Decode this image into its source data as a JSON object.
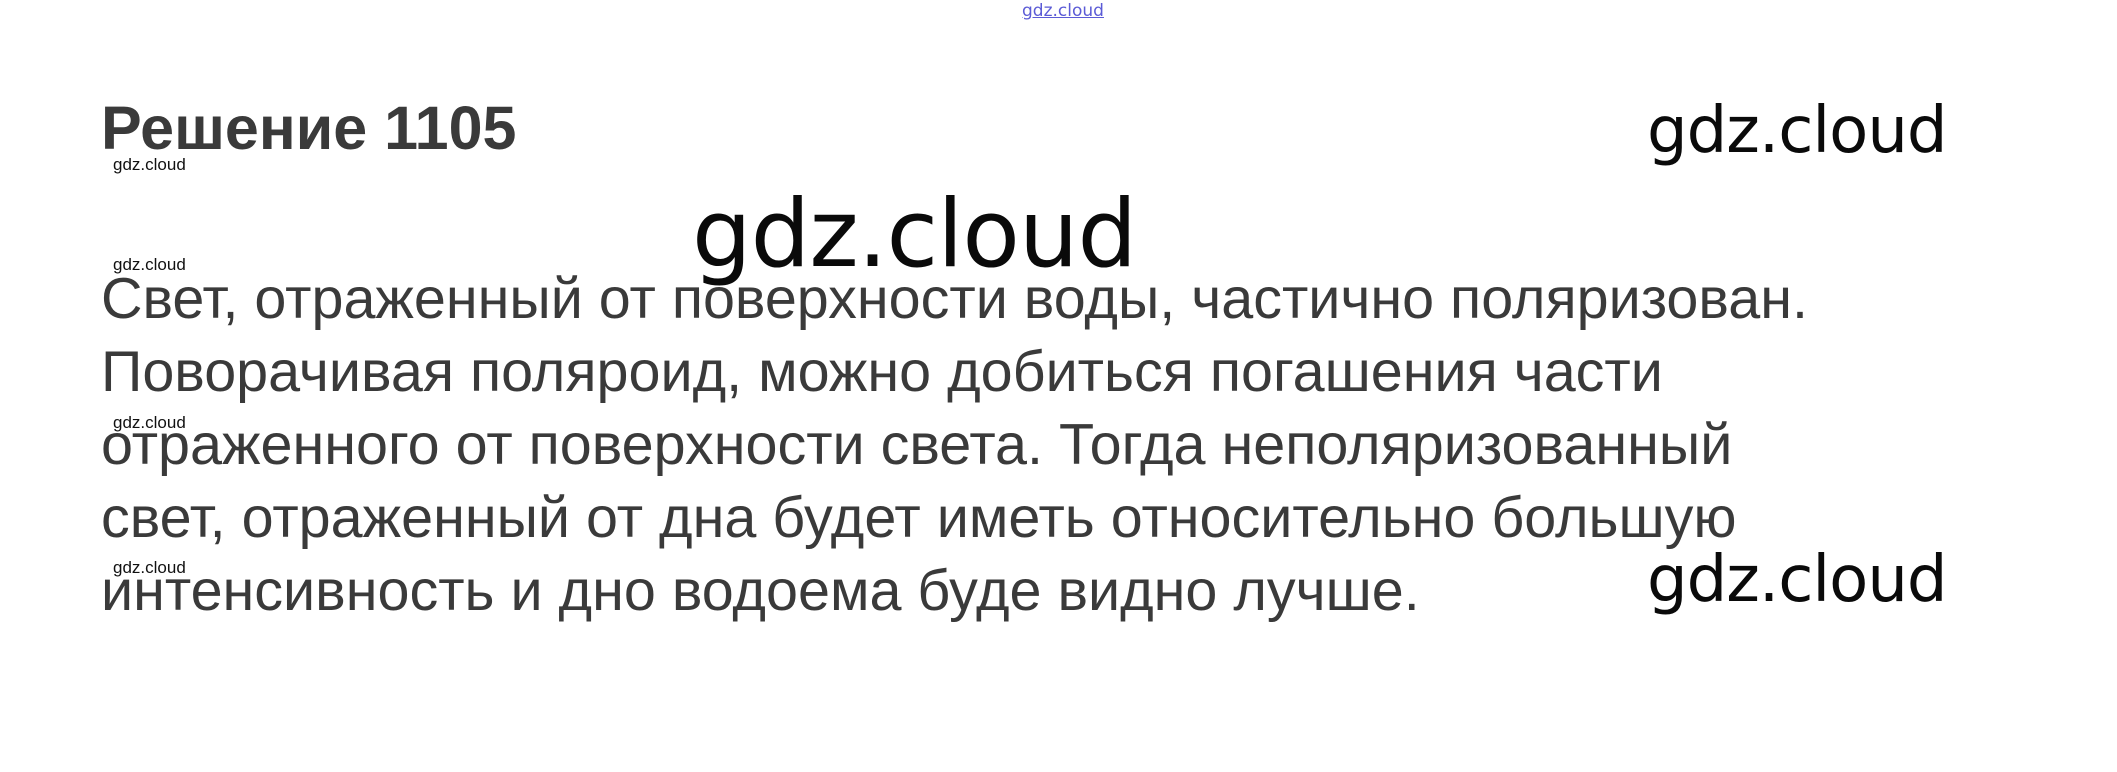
{
  "header": {
    "top_link": "gdz.cloud"
  },
  "solution": {
    "title": "Решение 1105",
    "lines": [
      "Свет, отраженный от поверхности воды, частично поляризован.",
      "Поворачивая поляроид, можно добиться погашения части",
      "отраженного от поверхности света. Тогда неполяризованный",
      "свет, отраженный от дна будет иметь относительно большую",
      "интенсивность и дно водоема буде видно лучше."
    ]
  },
  "watermarks": {
    "small": [
      "gdz.cloud",
      "gdz.cloud",
      "gdz.cloud",
      "gdz.cloud"
    ],
    "large_top_right": "gdz.cloud",
    "large_center": "gdz.cloud",
    "large_bottom_right": "gdz.cloud"
  }
}
